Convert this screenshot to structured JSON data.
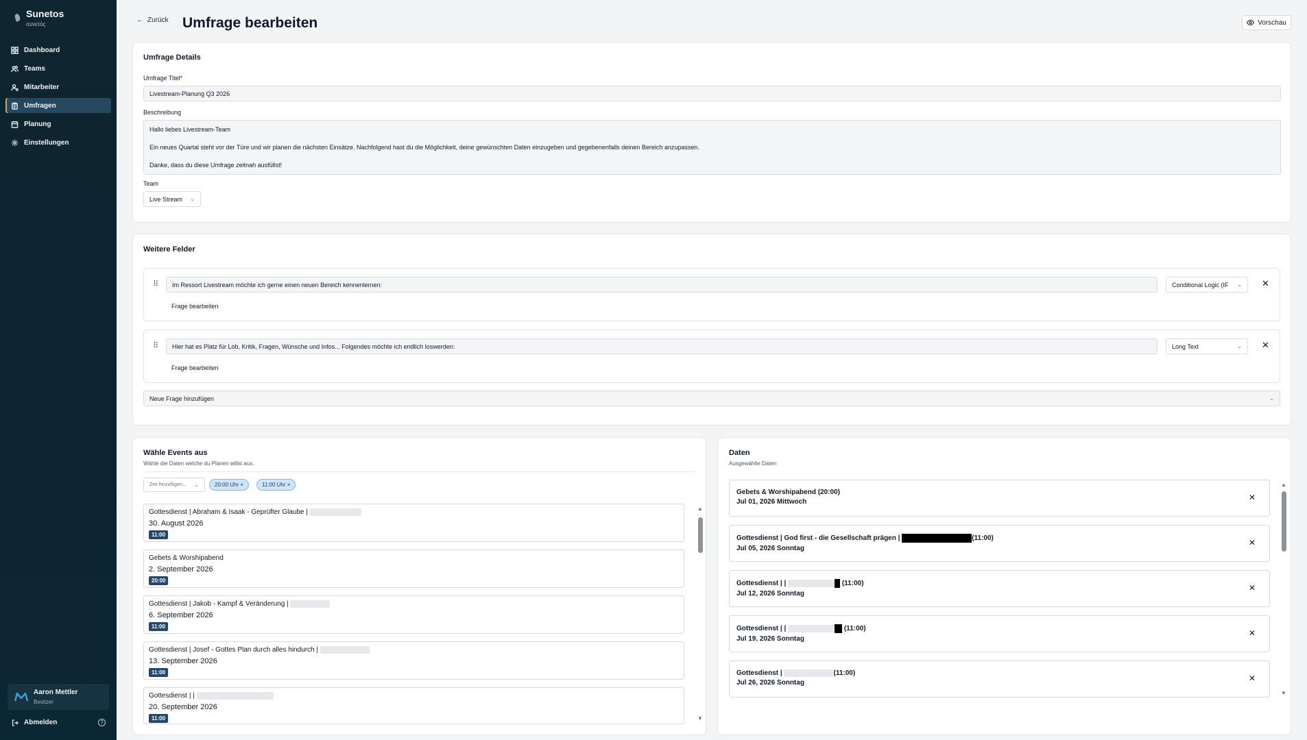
{
  "app": {
    "name": "Sunetos",
    "tagline": "συνετός"
  },
  "sidebar": {
    "items": [
      {
        "label": "Dashboard",
        "icon": "grid-icon"
      },
      {
        "label": "Teams",
        "icon": "users-icon"
      },
      {
        "label": "Mitarbeiter",
        "icon": "user-cog-icon"
      },
      {
        "label": "Umfragen",
        "icon": "clipboard-icon",
        "active": true
      },
      {
        "label": "Planung",
        "icon": "calendar-icon"
      },
      {
        "label": "Einstellungen",
        "icon": "gear-icon"
      }
    ],
    "user": {
      "name": "Aaron Mettler",
      "role": "Besitzer"
    },
    "logout_label": "Abmelden",
    "help_glyph": "?"
  },
  "header": {
    "back_label": "Zurück",
    "title": "Umfrage bearbeiten",
    "preview_label": "Vorschau"
  },
  "details": {
    "title": "Umfrage Details",
    "title_label": "Umfrage Titel*",
    "title_value": "Livestream-Planung Q3 2026",
    "description_label": "Beschreibung",
    "description_value": "Hallo liebes Livestream-Team\n\nEin neues Quartal steht vor der Türe und wir planen die nächsten Einsätze. Nachfolgend hast du die Möglichkeit, deine gewünschten Daten einzugeben und gegebenenfalls deinen Bereich anzupassen.\n\nDanke, dass du diese Umfrage zeitnah ausfüllst!",
    "team_label": "Team",
    "team_value": "Live Stream"
  },
  "fields": {
    "title": "Weitere Felder",
    "questions": [
      {
        "text": "Im Ressort Livestream möchte ich gerne einen neuen Bereich kennenlernen:",
        "type": "Conditional Logic (IF",
        "edit_label": "Frage bearbeiten"
      },
      {
        "text": "Hier hat es Platz für Lob, Kritik, Fragen, Wünsche und Infos... Folgendes möchte ich endlich loswerden:",
        "type": "Long Text",
        "edit_label": "Frage bearbeiten"
      }
    ],
    "add_label": "Neue Frage hinzufügen"
  },
  "events": {
    "title": "Wähle Events aus",
    "subtitle": "Wähle die Daten welche du Planen willst aus.",
    "time_placeholder": "Zeit hinzufügen...",
    "chips": [
      "20:00 Uhr ×",
      "11:00 Uhr ×"
    ],
    "list": [
      {
        "title": "Gottesdienst | Abraham & Isaak - Geprüfter Glaube |",
        "date": "30. August 2026",
        "time": "11:00"
      },
      {
        "title": "Gebets & Worshipabend",
        "date": "2. September 2026",
        "time": "20:00"
      },
      {
        "title": "Gottesdienst | Jakob - Kampf & Veränderung |",
        "date": "6. September 2026",
        "time": "11:00"
      },
      {
        "title": "Gottesdienst | Josef - Gottes Plan durch alles hindurch |",
        "date": "13. September 2026",
        "time": "11:00"
      },
      {
        "title": "Gottesdienst | |",
        "date": "20. September 2026",
        "time": "11:00"
      }
    ]
  },
  "selected": {
    "title": "Daten",
    "subtitle": "Ausgewählte Daten",
    "list": [
      {
        "title": "Gebets & Worshipabend (20:00)",
        "date": "Jul 01, 2026 Mittwoch"
      },
      {
        "title": "Gottesdienst | God first - die Gesellschaft prägen |",
        "suffix": "(11:00)",
        "date": "Jul 05, 2026 Sonntag"
      },
      {
        "title": "Gottesdienst | |",
        "suffix": "(11:00)",
        "date": "Jul 12, 2026 Sonntag"
      },
      {
        "title": "Gottesdienst | |",
        "suffix": "(11:00)",
        "date": "Jul 19, 2026 Sonntag"
      },
      {
        "title": "Gottesdienst |",
        "suffix": "(11:00)",
        "date": "Jul 26, 2026 Sonntag"
      }
    ]
  },
  "colors": {
    "sidebar_bg": "#0f2530",
    "accent": "#24476b",
    "chip_bg": "#cfe4f7"
  }
}
